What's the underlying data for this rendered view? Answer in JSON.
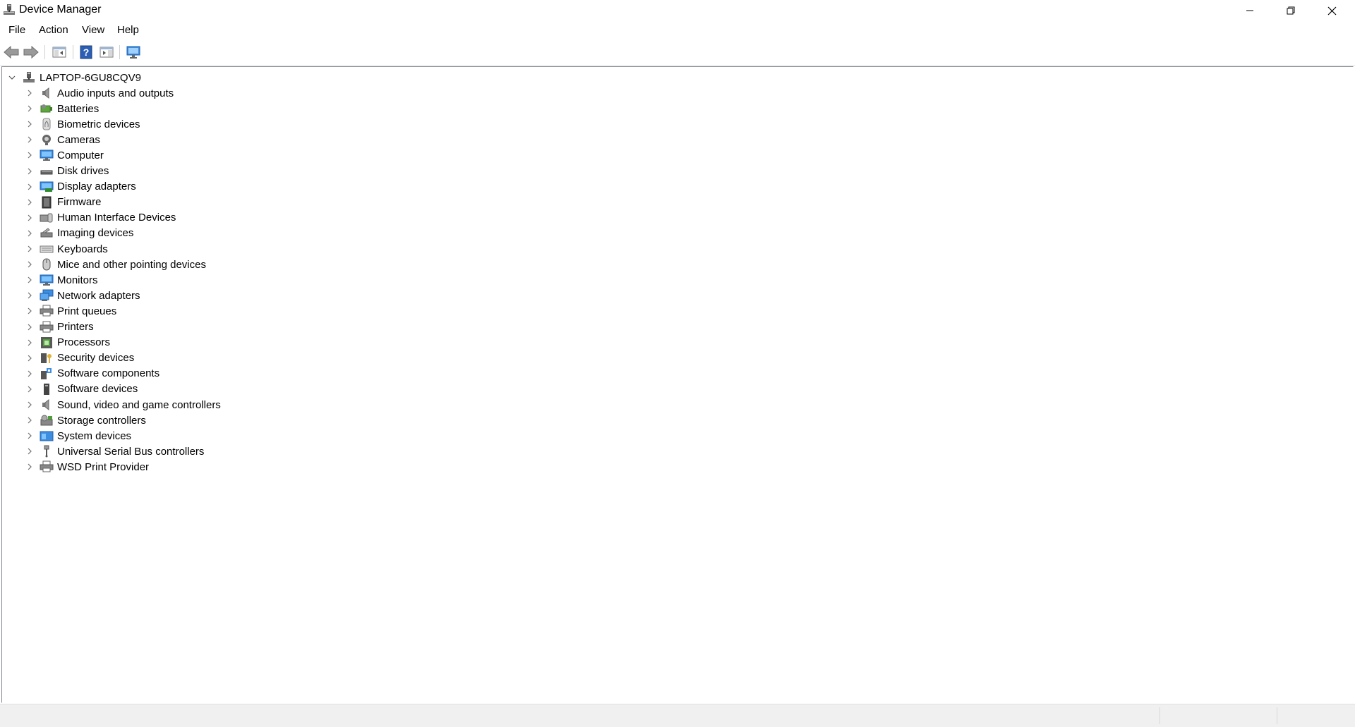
{
  "window": {
    "title": "Device Manager",
    "icon": "device-manager-icon"
  },
  "menu": {
    "items": [
      "File",
      "Action",
      "View",
      "Help"
    ]
  },
  "toolbar": {
    "buttons": [
      "back-arrow-icon",
      "forward-arrow-icon",
      "show-hide-console-tree-icon",
      "help-icon",
      "properties-pane-icon",
      "monitor-scan-icon"
    ]
  },
  "tree": {
    "root": {
      "label": "LAPTOP-6GU8CQV9",
      "icon": "computer-tower-icon",
      "expanded": true
    },
    "categories": [
      {
        "label": "Audio inputs and outputs",
        "icon": "speaker-icon"
      },
      {
        "label": "Batteries",
        "icon": "battery-icon"
      },
      {
        "label": "Biometric devices",
        "icon": "fingerprint-icon"
      },
      {
        "label": "Cameras",
        "icon": "camera-icon"
      },
      {
        "label": "Computer",
        "icon": "monitor-icon"
      },
      {
        "label": "Disk drives",
        "icon": "disk-drive-icon"
      },
      {
        "label": "Display adapters",
        "icon": "display-adapter-icon"
      },
      {
        "label": "Firmware",
        "icon": "firmware-chip-icon"
      },
      {
        "label": "Human Interface Devices",
        "icon": "hid-icon"
      },
      {
        "label": "Imaging devices",
        "icon": "imaging-icon"
      },
      {
        "label": "Keyboards",
        "icon": "keyboard-icon"
      },
      {
        "label": "Mice and other pointing devices",
        "icon": "mouse-icon"
      },
      {
        "label": "Monitors",
        "icon": "monitor-icon"
      },
      {
        "label": "Network adapters",
        "icon": "network-adapter-icon"
      },
      {
        "label": "Print queues",
        "icon": "printer-icon"
      },
      {
        "label": "Printers",
        "icon": "printer-icon"
      },
      {
        "label": "Processors",
        "icon": "processor-icon"
      },
      {
        "label": "Security devices",
        "icon": "security-key-icon"
      },
      {
        "label": "Software components",
        "icon": "software-component-icon"
      },
      {
        "label": "Software devices",
        "icon": "software-device-icon"
      },
      {
        "label": "Sound, video and game controllers",
        "icon": "speaker-icon"
      },
      {
        "label": "Storage controllers",
        "icon": "storage-controller-icon"
      },
      {
        "label": "System devices",
        "icon": "system-folder-icon"
      },
      {
        "label": "Universal Serial Bus controllers",
        "icon": "usb-icon"
      },
      {
        "label": "WSD Print Provider",
        "icon": "printer-icon"
      }
    ]
  },
  "colors": {
    "accent_blue": "#2b7bd6",
    "chevron": "#707070",
    "border": "#828790",
    "statusbar": "#f0f0f0"
  }
}
